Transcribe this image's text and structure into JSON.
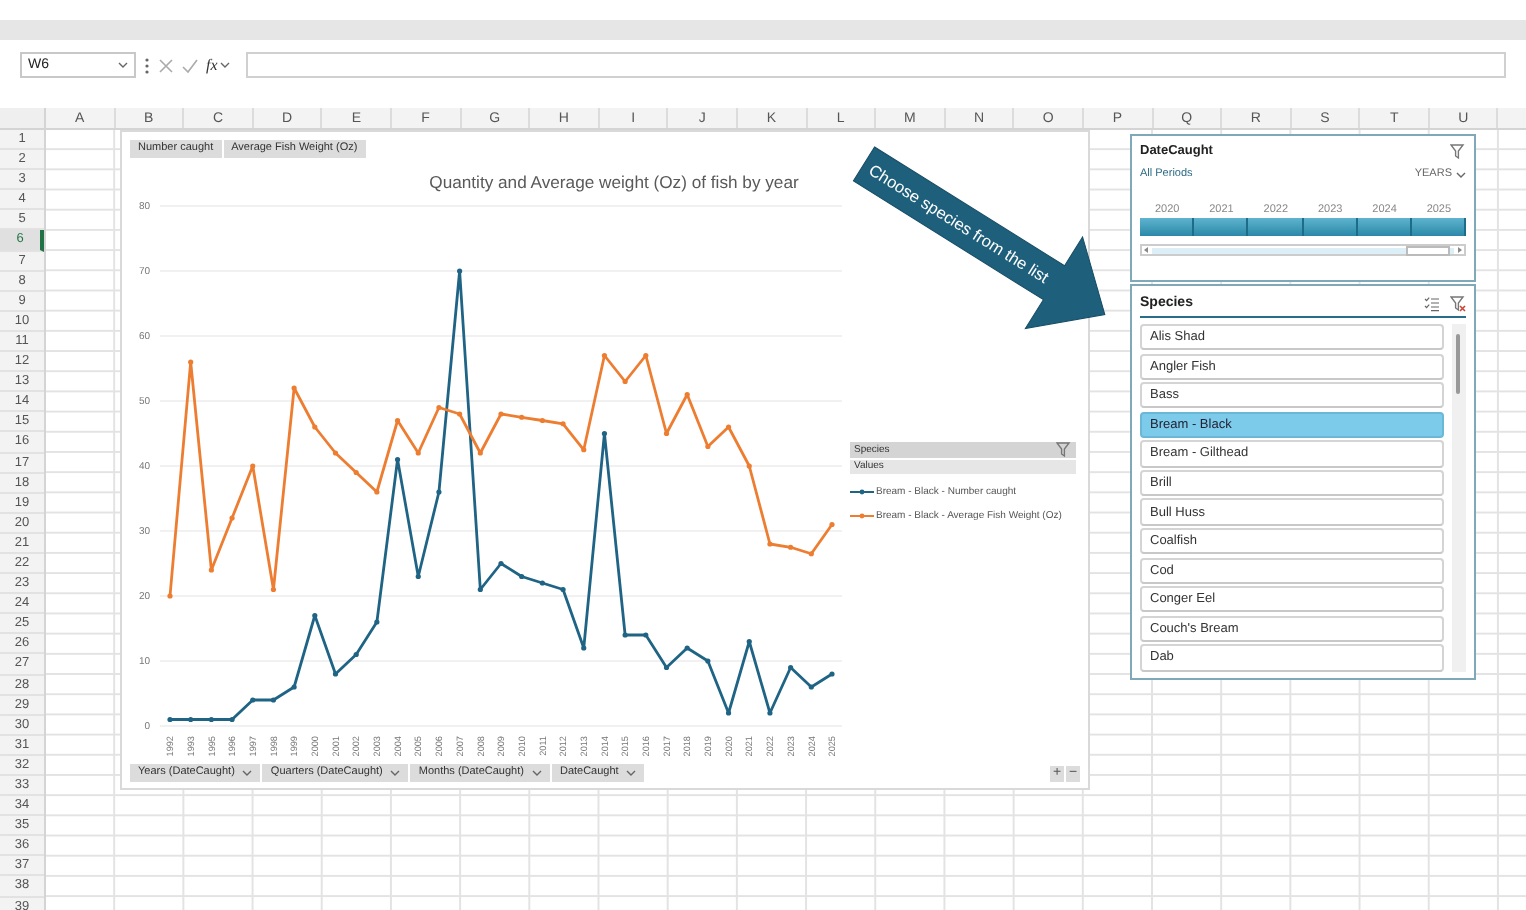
{
  "formula_bar": {
    "name_box": "W6",
    "function_label": "fx"
  },
  "sheet": {
    "columns": [
      "A",
      "B",
      "C",
      "D",
      "E",
      "F",
      "G",
      "H",
      "I",
      "J",
      "K",
      "L",
      "M",
      "N",
      "O",
      "P",
      "Q",
      "R",
      "S",
      "T",
      "U"
    ],
    "rows": [
      {
        "label": "1",
        "selected": false
      },
      {
        "label": "2",
        "selected": false
      },
      {
        "label": "3",
        "selected": false
      },
      {
        "label": "4",
        "selected": false
      },
      {
        "label": "5",
        "selected": false
      },
      {
        "label": "6",
        "selected": true
      },
      {
        "label": "7",
        "selected": false
      },
      {
        "label": "8",
        "selected": false
      },
      {
        "label": "9",
        "selected": false
      },
      {
        "label": "10",
        "selected": false
      },
      {
        "label": "11",
        "selected": false
      },
      {
        "label": "12",
        "selected": false
      },
      {
        "label": "13",
        "selected": false
      },
      {
        "label": "14",
        "selected": false
      },
      {
        "label": "15",
        "selected": false
      },
      {
        "label": "16",
        "selected": false
      },
      {
        "label": "17",
        "selected": false
      },
      {
        "label": "18",
        "selected": false
      },
      {
        "label": "19",
        "selected": false
      },
      {
        "label": "20",
        "selected": false
      },
      {
        "label": "21",
        "selected": false
      },
      {
        "label": "22",
        "selected": false
      },
      {
        "label": "23",
        "selected": false
      },
      {
        "label": "24",
        "selected": false
      },
      {
        "label": "25",
        "selected": false
      },
      {
        "label": "26",
        "selected": false
      },
      {
        "label": "27",
        "selected": false
      },
      {
        "label": "28",
        "selected": false
      },
      {
        "label": "29",
        "selected": false
      },
      {
        "label": "30",
        "selected": false
      },
      {
        "label": "31",
        "selected": false
      },
      {
        "label": "32",
        "selected": false
      },
      {
        "label": "33",
        "selected": false
      },
      {
        "label": "34",
        "selected": false
      },
      {
        "label": "35",
        "selected": false
      },
      {
        "label": "36",
        "selected": false
      },
      {
        "label": "37",
        "selected": false
      },
      {
        "label": "38",
        "selected": false
      },
      {
        "label": "39",
        "selected": false
      }
    ]
  },
  "chart": {
    "field_buttons": [
      "Number caught",
      "Average Fish Weight (Oz)"
    ],
    "axis_field_buttons": [
      "Years (DateCaught)",
      "Quarters (DateCaught)",
      "Months (DateCaught)",
      "DateCaught"
    ],
    "legend": {
      "title": "Species",
      "subtitle": "Values"
    },
    "zoom_buttons": [
      "+",
      "−"
    ],
    "chart_data": {
      "type": "line",
      "title": "Quantity and Average weight (Oz) of fish by year",
      "categories": [
        "1992",
        "1993",
        "1995",
        "1996",
        "1997",
        "1998",
        "1999",
        "2000",
        "2001",
        "2002",
        "2003",
        "2004",
        "2005",
        "2006",
        "2007",
        "2008",
        "2009",
        "2010",
        "2011",
        "2012",
        "2013",
        "2014",
        "2015",
        "2016",
        "2017",
        "2018",
        "2019",
        "2020",
        "2021",
        "2022",
        "2023",
        "2024",
        "2025"
      ],
      "series": [
        {
          "name": "Bream - Black - Number caught",
          "color": "#1f6484",
          "values": [
            1,
            1,
            1,
            1,
            4,
            4,
            6,
            17,
            8,
            11,
            16,
            41,
            23,
            36,
            70,
            21,
            25,
            23,
            22,
            21,
            12,
            45,
            14,
            14,
            9,
            12,
            10,
            2,
            13,
            2,
            9,
            6,
            8
          ]
        },
        {
          "name": "Bream - Black - Average Fish Weight (Oz)",
          "color": "#ed7d31",
          "values": [
            20,
            56,
            24,
            32,
            40,
            21,
            52,
            46,
            42,
            39,
            36,
            47,
            42,
            49,
            48,
            42,
            48,
            47.5,
            47,
            46.5,
            42.5,
            57,
            53,
            57,
            45,
            51,
            43,
            46,
            40,
            28,
            27.5,
            26.5,
            31
          ]
        }
      ],
      "grid": true,
      "ylim": [
        0,
        80
      ],
      "yticks": [
        0,
        10,
        20,
        30,
        40,
        50,
        60,
        70,
        80
      ]
    }
  },
  "callout": {
    "text": "Choose species from the list"
  },
  "timeline_slicer": {
    "title": "DateCaught",
    "period_label": "All Periods",
    "level_label": "YEARS",
    "years": [
      "2020",
      "2021",
      "2022",
      "2023",
      "2024",
      "2025"
    ]
  },
  "species_slicer": {
    "title": "Species",
    "items": [
      {
        "label": "Alis Shad",
        "selected": false
      },
      {
        "label": "Angler Fish",
        "selected": false
      },
      {
        "label": "Bass",
        "selected": false
      },
      {
        "label": "Bream - Black",
        "selected": true
      },
      {
        "label": "Bream - Gilthead",
        "selected": false
      },
      {
        "label": "Brill",
        "selected": false
      },
      {
        "label": "Bull Huss",
        "selected": false
      },
      {
        "label": "Coalfish",
        "selected": false
      },
      {
        "label": "Cod",
        "selected": false
      },
      {
        "label": "Conger Eel",
        "selected": false
      },
      {
        "label": "Couch's Bream",
        "selected": false
      },
      {
        "label": "Dab",
        "selected": false
      }
    ]
  }
}
